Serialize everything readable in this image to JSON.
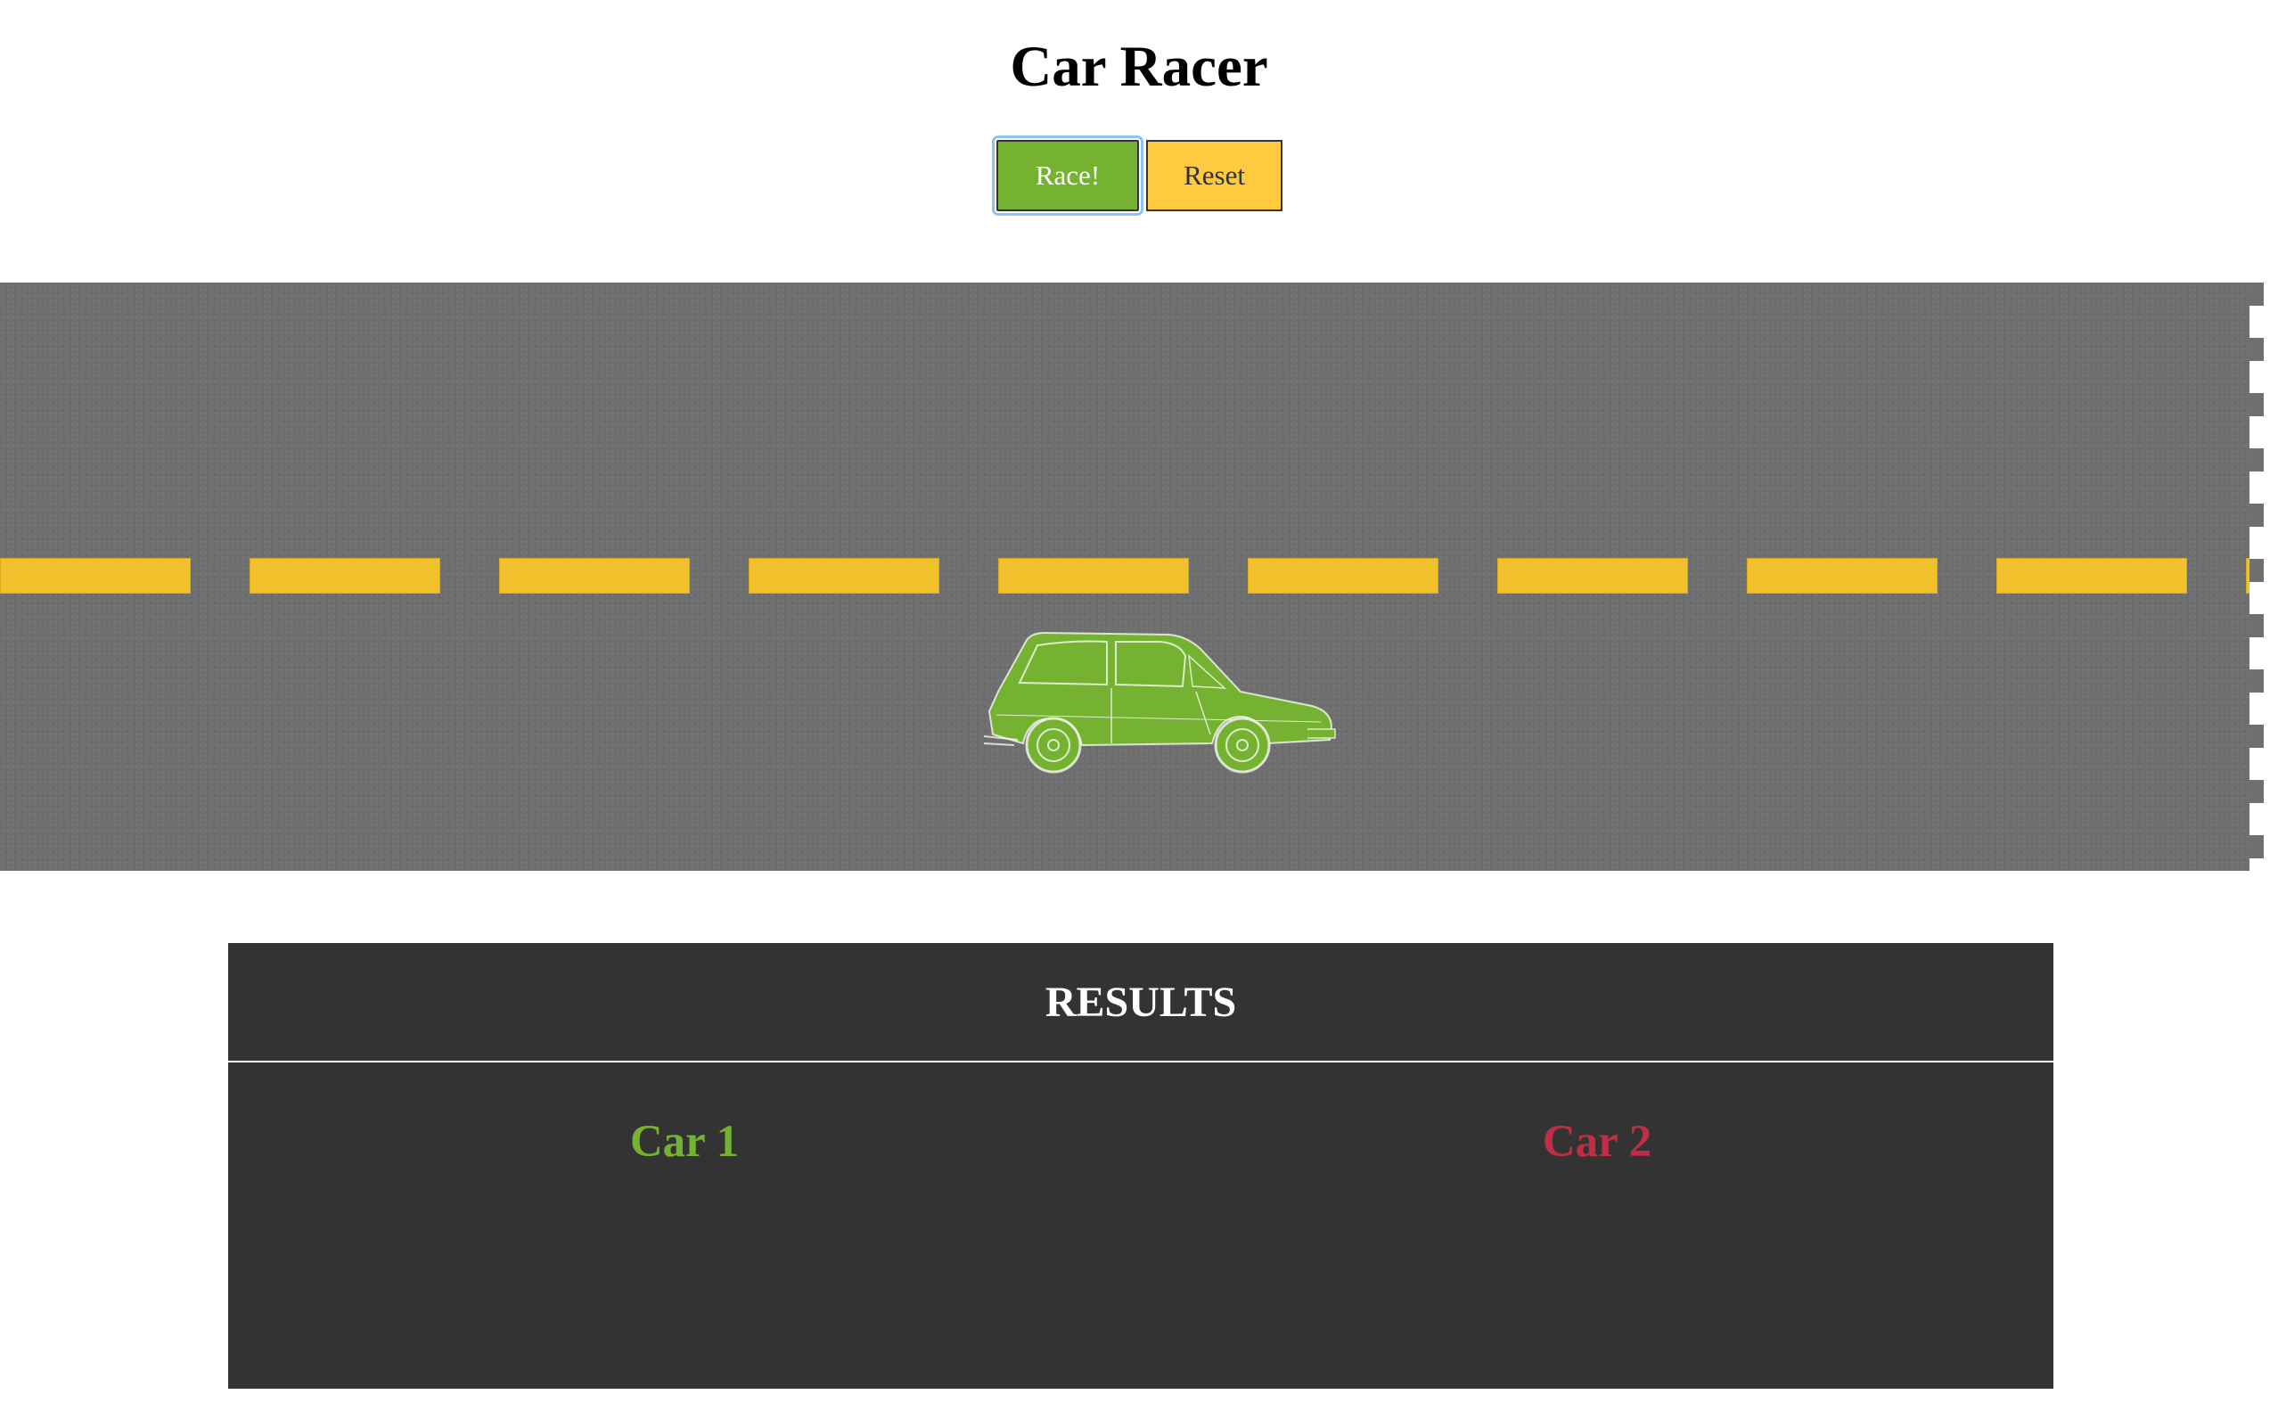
{
  "header": {
    "title": "Car Racer"
  },
  "controls": {
    "race_label": "Race!",
    "reset_label": "Reset"
  },
  "track": {
    "surface": "asphalt",
    "lane_divider_color": "#f2c22c",
    "finish_line": "checkered-edge",
    "cars": [
      {
        "name": "Car 1",
        "color": "#76b232",
        "icon": "hatchback-car-icon"
      },
      {
        "name": "Car 2",
        "color": "#c12d44",
        "icon": "hatchback-car-icon"
      }
    ]
  },
  "results": {
    "heading": "RESULTS",
    "columns": [
      {
        "label": "Car 1",
        "color": "#76b232"
      },
      {
        "label": "Car 2",
        "color": "#c12d44"
      }
    ]
  },
  "colors": {
    "race_button": "#76b232",
    "reset_button": "#ffc940",
    "results_panel": "#333333",
    "track": "#6f6f6f"
  }
}
